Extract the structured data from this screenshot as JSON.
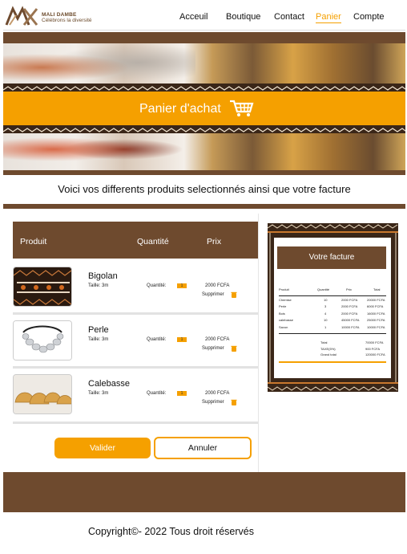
{
  "header": {
    "brand_name": "MALI DAMBE",
    "brand_tagline": "Célébrons la diversité",
    "nav": [
      {
        "label": "Acceuil"
      },
      {
        "label": "Boutique"
      },
      {
        "label": "Contact"
      },
      {
        "label": "Panier",
        "active": true
      },
      {
        "label": "Compte"
      }
    ]
  },
  "banner": {
    "title": "Panier d'achat",
    "icon": "shopping-cart-icon"
  },
  "subtitle": "Voici vos differents produits selectionnés ainsi que votre facture",
  "table": {
    "col_product": "Produit",
    "col_quantity": "Quantité",
    "col_price": "Prix"
  },
  "products": [
    {
      "name": "Bigolan",
      "size": "Taille: 3m",
      "qty_label": "Quantité:",
      "qty": "1",
      "price": "2000 FCFA",
      "remove": "Supprimer"
    },
    {
      "name": "Perle",
      "size": "Taille: 3m",
      "qty_label": "Quantité:",
      "qty": "1",
      "price": "2000 FCFA",
      "remove": "Supprimer"
    },
    {
      "name": "Calebasse",
      "size": "Taille: 3m",
      "qty_label": "Quantité:",
      "qty": "1",
      "price": "2000 FCFA",
      "remove": "Supprimer"
    }
  ],
  "buttons": {
    "validate": "Valider",
    "cancel": "Annuler"
  },
  "invoice": {
    "title": "Votre facture",
    "cols": [
      "Produit",
      "Quantité",
      "Prix",
      "Total"
    ],
    "rows": [
      [
        "Chemise",
        "10",
        "2000 FCFA",
        "20000 FCFA"
      ],
      [
        "Perle",
        "3",
        "2000 FCFA",
        "6000 FCFA"
      ],
      [
        "Bois",
        "4",
        "2000 FCFA",
        "16000 FCFA"
      ],
      [
        "calebasse",
        "10",
        "45000 FCFA",
        "25000 FCFA"
      ],
      [
        "Savon",
        "1",
        "10000 FCFA",
        "10000 FCFA"
      ]
    ],
    "total_label": "Total",
    "total_value": "70000 FCFA",
    "tax_label": "TAXE(5%)",
    "tax_value": "900 FCFA",
    "grand_label": "Grand total",
    "grand_value": "120000 FCFA"
  },
  "footer": {
    "copyright": "Copyright©- 2022 Tous droit réservés"
  },
  "colors": {
    "brown": "#6e4a2e",
    "orange": "#f5a000",
    "dark": "#3a2618"
  }
}
